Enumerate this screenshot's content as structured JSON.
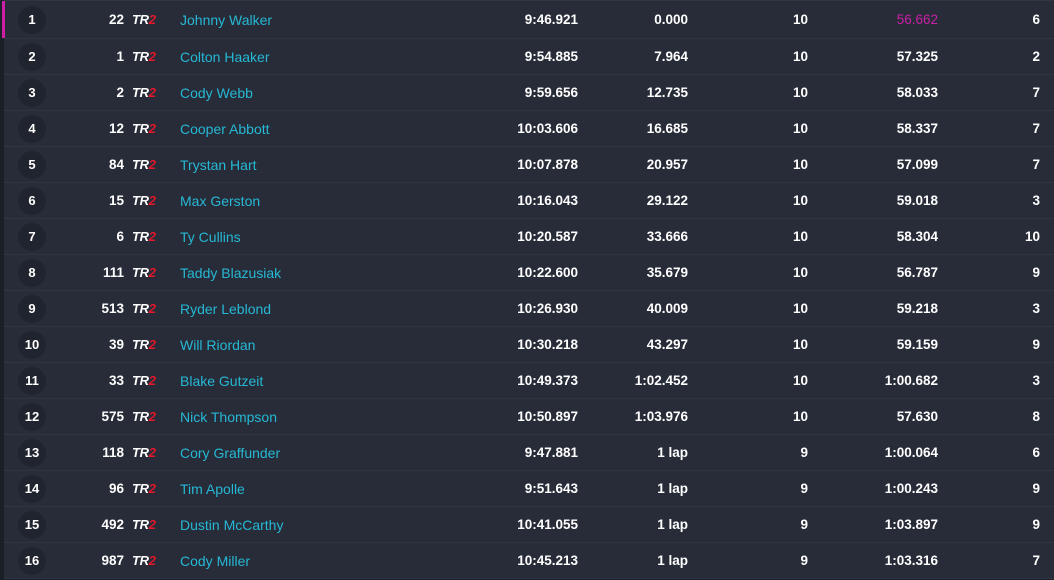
{
  "table": {
    "accent_color": "#cc1fa5",
    "link_color": "#26b8d4",
    "class_badge": {
      "prefix": "TR",
      "suffix": "2"
    },
    "rows": [
      {
        "position": "1",
        "number": "22",
        "class": "TR2",
        "driver": "Johnny Walker",
        "time": "9:46.921",
        "gap": "0.000",
        "laps": "10",
        "best": "56.662",
        "best_lap": "6",
        "fastest": true
      },
      {
        "position": "2",
        "number": "1",
        "class": "TR2",
        "driver": "Colton Haaker",
        "time": "9:54.885",
        "gap": "7.964",
        "laps": "10",
        "best": "57.325",
        "best_lap": "2",
        "fastest": false
      },
      {
        "position": "3",
        "number": "2",
        "class": "TR2",
        "driver": "Cody Webb",
        "time": "9:59.656",
        "gap": "12.735",
        "laps": "10",
        "best": "58.033",
        "best_lap": "7",
        "fastest": false
      },
      {
        "position": "4",
        "number": "12",
        "class": "TR2",
        "driver": "Cooper Abbott",
        "time": "10:03.606",
        "gap": "16.685",
        "laps": "10",
        "best": "58.337",
        "best_lap": "7",
        "fastest": false
      },
      {
        "position": "5",
        "number": "84",
        "class": "TR2",
        "driver": "Trystan Hart",
        "time": "10:07.878",
        "gap": "20.957",
        "laps": "10",
        "best": "57.099",
        "best_lap": "7",
        "fastest": false
      },
      {
        "position": "6",
        "number": "15",
        "class": "TR2",
        "driver": "Max Gerston",
        "time": "10:16.043",
        "gap": "29.122",
        "laps": "10",
        "best": "59.018",
        "best_lap": "3",
        "fastest": false
      },
      {
        "position": "7",
        "number": "6",
        "class": "TR2",
        "driver": "Ty Cullins",
        "time": "10:20.587",
        "gap": "33.666",
        "laps": "10",
        "best": "58.304",
        "best_lap": "10",
        "fastest": false
      },
      {
        "position": "8",
        "number": "111",
        "class": "TR2",
        "driver": "Taddy Blazusiak",
        "time": "10:22.600",
        "gap": "35.679",
        "laps": "10",
        "best": "56.787",
        "best_lap": "9",
        "fastest": false
      },
      {
        "position": "9",
        "number": "513",
        "class": "TR2",
        "driver": "Ryder Leblond",
        "time": "10:26.930",
        "gap": "40.009",
        "laps": "10",
        "best": "59.218",
        "best_lap": "3",
        "fastest": false
      },
      {
        "position": "10",
        "number": "39",
        "class": "TR2",
        "driver": "Will Riordan",
        "time": "10:30.218",
        "gap": "43.297",
        "laps": "10",
        "best": "59.159",
        "best_lap": "9",
        "fastest": false
      },
      {
        "position": "11",
        "number": "33",
        "class": "TR2",
        "driver": "Blake Gutzeit",
        "time": "10:49.373",
        "gap": "1:02.452",
        "laps": "10",
        "best": "1:00.682",
        "best_lap": "3",
        "fastest": false
      },
      {
        "position": "12",
        "number": "575",
        "class": "TR2",
        "driver": "Nick Thompson",
        "time": "10:50.897",
        "gap": "1:03.976",
        "laps": "10",
        "best": "57.630",
        "best_lap": "8",
        "fastest": false
      },
      {
        "position": "13",
        "number": "118",
        "class": "TR2",
        "driver": "Cory Graffunder",
        "time": "9:47.881",
        "gap": "1 lap",
        "laps": "9",
        "best": "1:00.064",
        "best_lap": "6",
        "fastest": false
      },
      {
        "position": "14",
        "number": "96",
        "class": "TR2",
        "driver": "Tim Apolle",
        "time": "9:51.643",
        "gap": "1 lap",
        "laps": "9",
        "best": "1:00.243",
        "best_lap": "9",
        "fastest": false
      },
      {
        "position": "15",
        "number": "492",
        "class": "TR2",
        "driver": "Dustin McCarthy",
        "time": "10:41.055",
        "gap": "1 lap",
        "laps": "9",
        "best": "1:03.897",
        "best_lap": "9",
        "fastest": false
      },
      {
        "position": "16",
        "number": "987",
        "class": "TR2",
        "driver": "Cody Miller",
        "time": "10:45.213",
        "gap": "1 lap",
        "laps": "9",
        "best": "1:03.316",
        "best_lap": "7",
        "fastest": false
      }
    ]
  }
}
